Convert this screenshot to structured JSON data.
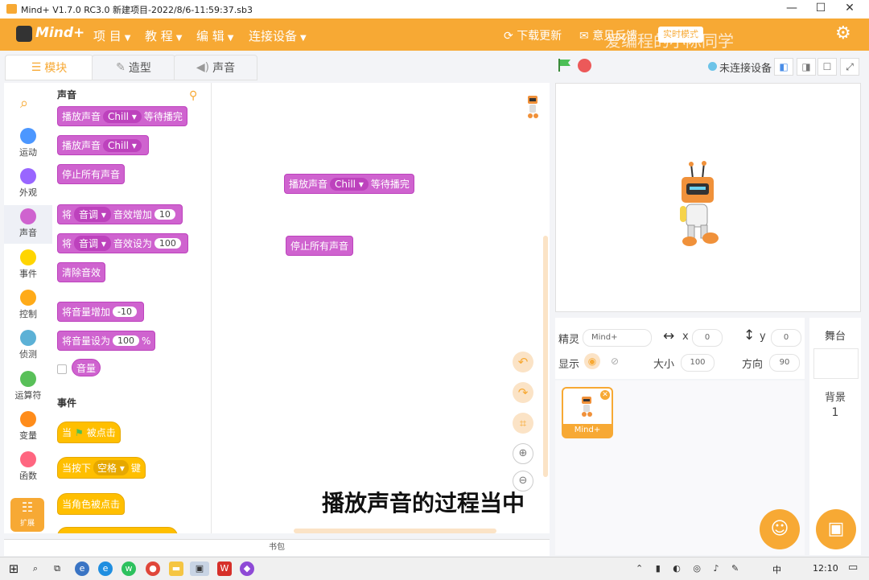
{
  "titlebar": {
    "title": "Mind+ V1.7.0 RC3.0   新建项目-2022/8/6-11:59:37.sb3",
    "minimize": "—",
    "maximize": "☐",
    "close": "✕"
  },
  "menubar": {
    "logo": "Mind+",
    "items": [
      "项 目",
      "教 程",
      "编 辑",
      "连接设备"
    ],
    "update": "下载更新",
    "feedback": "意见反馈",
    "mode_button": "实时模式",
    "watermark": "爱编程的小陈同学"
  },
  "tabs": {
    "blocks": "模块",
    "costumes": "造型",
    "sounds": "声音"
  },
  "toolbar": {
    "connection": "未连接设备"
  },
  "categories": [
    {
      "label": "运动",
      "color": "#4c97ff"
    },
    {
      "label": "外观",
      "color": "#9966ff"
    },
    {
      "label": "声音",
      "color": "#cf63cf"
    },
    {
      "label": "事件",
      "color": "#ffd500"
    },
    {
      "label": "控制",
      "color": "#ffab19"
    },
    {
      "label": "侦测",
      "color": "#5cb1d6"
    },
    {
      "label": "运算符",
      "color": "#59c059"
    },
    {
      "label": "变量",
      "color": "#ff8c1a"
    },
    {
      "label": "函数",
      "color": "#ff6680"
    }
  ],
  "extension": "扩展",
  "palette": {
    "sound_header": "声音",
    "play_until_done": {
      "pre": "播放声音",
      "sound": "Chill",
      "post": "等待播完"
    },
    "start_sound": {
      "pre": "播放声音",
      "sound": "Chill"
    },
    "stop_all": "停止所有声音",
    "change_effect": {
      "pre": "将",
      "effect": "音调",
      "mid": "音效增加",
      "value": "10"
    },
    "set_effect": {
      "pre": "将",
      "effect": "音调",
      "mid": "音效设为",
      "value": "100"
    },
    "clear_effects": "清除音效",
    "change_volume": {
      "pre": "将音量增加",
      "value": "-10"
    },
    "set_volume": {
      "pre": "将音量设为",
      "value": "100",
      "post": "%"
    },
    "volume": "音量",
    "events_header": "事件",
    "when_flag": {
      "pre": "当",
      "post": "被点击"
    },
    "when_key": {
      "pre": "当按下",
      "key": "空格",
      "post": "键"
    },
    "when_sprite": "当角色被点击"
  },
  "script": {
    "block1": {
      "pre": "播放声音",
      "sound": "Chill",
      "post": "等待播完"
    },
    "block2": "停止所有声音",
    "caption": "播放声音的过程当中"
  },
  "backpack": "书包",
  "sprite_info": {
    "sprite_label": "精灵",
    "sprite_name": "Mind+",
    "x_label": "x",
    "x": "0",
    "y_label": "y",
    "y": "0",
    "show_label": "显示",
    "size_label": "大小",
    "size": "100",
    "direction_label": "方向",
    "direction": "90"
  },
  "sprite_list": [
    {
      "name": "Mind+"
    }
  ],
  "stage_panel": {
    "title": "舞台",
    "backdrop_label": "背景",
    "backdrop_count": "1"
  },
  "taskbar": {
    "time": "12:10",
    "ime": "中"
  }
}
